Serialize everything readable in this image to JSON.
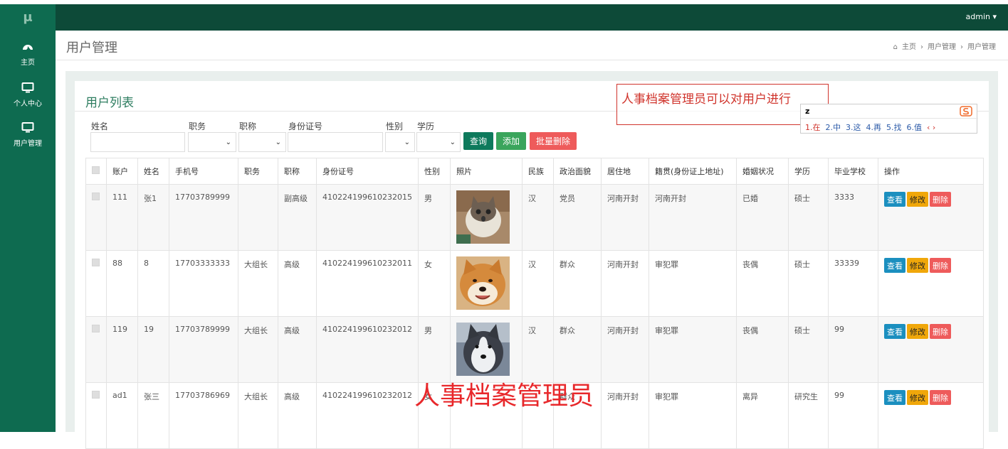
{
  "app": {
    "logo": "μ",
    "user": "admin ▾"
  },
  "sidebar": {
    "items": [
      {
        "label": "主页",
        "icon": "dashboard-icon"
      },
      {
        "label": "个人中心",
        "icon": "monitor-icon"
      },
      {
        "label": "用户管理",
        "icon": "monitor-icon"
      }
    ]
  },
  "page": {
    "title": "用户管理",
    "breadcrumb": [
      "主页",
      "用户管理",
      "用户管理"
    ],
    "list_title": "用户列表"
  },
  "filters": {
    "name_label": "姓名",
    "position_label": "职务",
    "rank_label": "职称",
    "idcard_label": "身份证号",
    "gender_label": "性别",
    "education_label": "学历",
    "search_btn": "查询",
    "add_btn": "添加",
    "batch_delete_btn": "批量删除"
  },
  "table": {
    "headers": [
      "",
      "账户",
      "姓名",
      "手机号",
      "职务",
      "职称",
      "身份证号",
      "性别",
      "照片",
      "民族",
      "政治面貌",
      "居住地",
      "籍贯(身份证上地址)",
      "婚姻状况",
      "学历",
      "毕业学校",
      "操作"
    ],
    "actions": {
      "view": "查看",
      "edit": "修改",
      "delete": "删除"
    },
    "rows": [
      {
        "account": "111",
        "name": "张1",
        "phone": "17703789999",
        "position": "",
        "rank": "副高级",
        "idcard": "410224199610232015",
        "gender": "男",
        "photo": "cat",
        "ethnic": "汉",
        "political": "党员",
        "residence": "河南开封",
        "native": "河南开封",
        "marital": "已婚",
        "education": "硕士",
        "school": "3333"
      },
      {
        "account": "88",
        "name": "8",
        "phone": "17703333333",
        "position": "大组长",
        "rank": "高级",
        "idcard": "410224199610232011",
        "gender": "女",
        "photo": "shiba",
        "ethnic": "汉",
        "political": "群众",
        "residence": "河南开封",
        "native": "审犯罪",
        "marital": "丧偶",
        "education": "硕士",
        "school": "33339"
      },
      {
        "account": "119",
        "name": "19",
        "phone": "17703789999",
        "position": "大组长",
        "rank": "高级",
        "idcard": "410224199610232012",
        "gender": "男",
        "photo": "husky",
        "ethnic": "汉",
        "political": "群众",
        "residence": "河南开封",
        "native": "审犯罪",
        "marital": "丧偶",
        "education": "硕士",
        "school": "99"
      },
      {
        "account": "ad1",
        "name": "张三",
        "phone": "17703786969",
        "position": "大组长",
        "rank": "高级",
        "idcard": "410224199610232012",
        "gender": "女",
        "photo": "",
        "ethnic": "",
        "political": "群众",
        "residence": "河南开封",
        "native": "审犯罪",
        "marital": "离异",
        "education": "研究生",
        "school": "99"
      }
    ]
  },
  "overlay": {
    "annotation": "人事档案管理员可以对用户进行",
    "ime_input": "z",
    "ime_candidates": [
      "1.在",
      "2.中",
      "3.这",
      "4.再",
      "5.找",
      "6.值"
    ],
    "ime_arrows": "‹ ›",
    "caption": "人事档案管理员"
  },
  "colors": {
    "sidebar": "#0e6b50",
    "topbar": "#0d4a38",
    "search": "#0e7a5c",
    "add": "#3aa55c",
    "batch_delete": "#ee5b5b",
    "view": "#1b8fbf",
    "edit": "#f0a70a",
    "delete": "#ee5b5b"
  }
}
